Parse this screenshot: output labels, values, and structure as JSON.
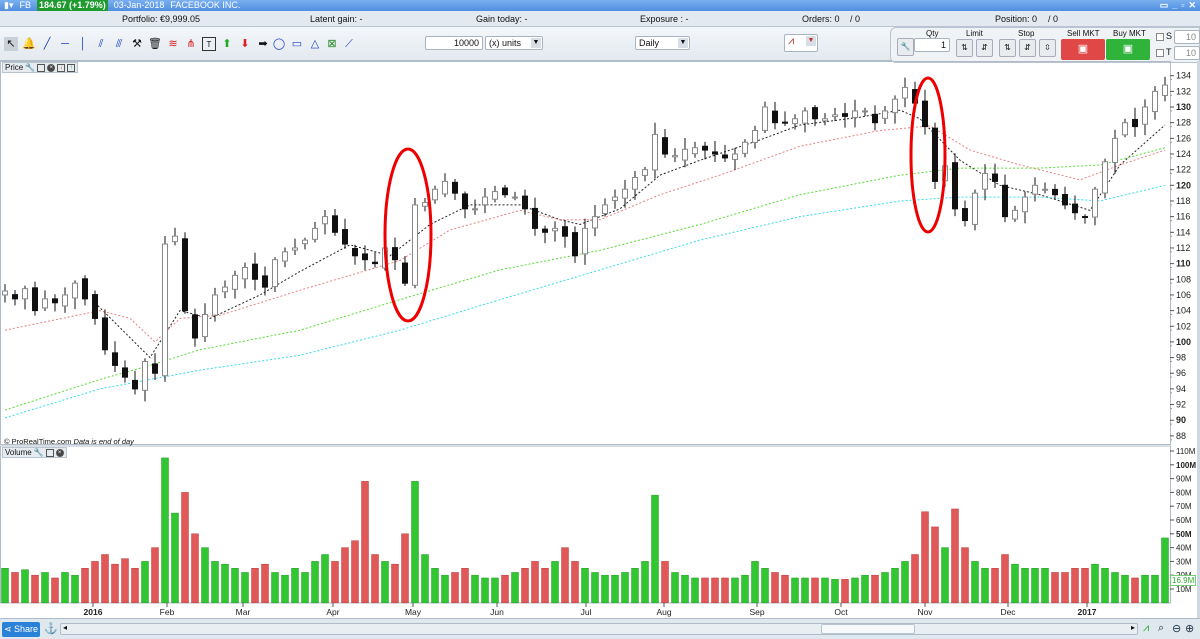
{
  "titlebar": {
    "symbol": "FB",
    "price_change": "184.67 (+1.79%)",
    "date": "03-Jan-2018",
    "name": "FACEBOOK INC.",
    "window_buttons": [
      "▭",
      "_",
      "▫",
      "✕"
    ]
  },
  "info": {
    "portfolio": "Portfolio: €9,999.05",
    "latent_gain": "Latent gain: -",
    "gain_today": "Gain today: -",
    "exposure": "Exposure : -",
    "orders": "Orders: 0",
    "orders_b": "/ 0",
    "position": "Position: 0",
    "position_b": "/ 0"
  },
  "toolbar": {
    "tools": [
      "pointer",
      "alert-bell",
      "trendline",
      "horizontal-line",
      "vertical-line",
      "parallel-channel",
      "fan-lines",
      "tools-settings",
      "trash",
      "fibonacci",
      "fibonacci-fan",
      "text",
      "up-arrow",
      "down-arrow",
      "right-arrow",
      "ellipse",
      "rectangle",
      "triangle",
      "zone",
      "segment"
    ],
    "amount": "10000",
    "units": "(x) units",
    "period": "Daily"
  },
  "trade": {
    "qty_label": "Qty",
    "qty": "1",
    "limit_label": "Limit",
    "stop_label": "Stop",
    "sell_label": "Sell MKT",
    "buy_label": "Buy MKT",
    "s_label": "S",
    "t_label": "T",
    "s_value": "10",
    "t_value": "10",
    "sell_color": "#e04848",
    "buy_color": "#2fb33a"
  },
  "price_panel": {
    "label": "Price",
    "copyright": "© ProRealTime.com",
    "note": "Data is end of day"
  },
  "volume_panel": {
    "label": "Volume",
    "current": "16.9M"
  },
  "bottom": {
    "share_label": "Share"
  },
  "chart_data": [
    {
      "type": "candlestick",
      "ylim": [
        88,
        134
      ],
      "yticks": [
        88,
        90,
        92,
        94,
        96,
        98,
        100,
        102,
        104,
        106,
        108,
        110,
        112,
        114,
        116,
        118,
        120,
        122,
        124,
        126,
        128,
        130,
        132,
        134
      ],
      "xticks": [
        "2016",
        "Feb",
        "Mar",
        "Apr",
        "May",
        "Jun",
        "Jul",
        "Aug",
        "Sep",
        "Oct",
        "Nov",
        "Dec",
        "2017"
      ],
      "closes": [
        106.5,
        105.5,
        106.8,
        104,
        105.5,
        105,
        106,
        107.5,
        105.5,
        103,
        99,
        97,
        95.5,
        94,
        97.5,
        96,
        112.5,
        113.5,
        104,
        100.5,
        103.5,
        106,
        107,
        108.5,
        109.5,
        108,
        107,
        110.5,
        111.5,
        112,
        113,
        114.5,
        116,
        114,
        112.5,
        111,
        110.5,
        110,
        112,
        110.5,
        107.5,
        117.5,
        117.8,
        119.5,
        120.5,
        119,
        117,
        117,
        118.5,
        119.2,
        118.8,
        118.5,
        117,
        114.5,
        114,
        114.5,
        113.5,
        111,
        114.5,
        116,
        117.5,
        118.5,
        119.5,
        121,
        122,
        126.5,
        124,
        123.8,
        124.6,
        124.8,
        124.5,
        124,
        123.5,
        124,
        125.5,
        127,
        130,
        128,
        128,
        128.5,
        129.5,
        128.5,
        128.5,
        129,
        128.8,
        129.5,
        129.5,
        128,
        129.5,
        131,
        132.5,
        130.5,
        127.5,
        120.5,
        122.5,
        117,
        115.5,
        119,
        121.5,
        120.5,
        116,
        116.8,
        118.5,
        120,
        119.5,
        118.8,
        117.5,
        116.5,
        116,
        119.5,
        123,
        126,
        128,
        127.5,
        130,
        132,
        132.8
      ],
      "moving_averages": [
        {
          "color": "#222222",
          "points": [
            [
              9,
              105
            ],
            [
              14.5,
              98
            ],
            [
              17.5,
              104
            ],
            [
              20.5,
              103
            ],
            [
              25.5,
              106
            ],
            [
              29.5,
              109
            ],
            [
              34.5,
              112.4
            ],
            [
              38.5,
              111
            ],
            [
              42.5,
              115
            ],
            [
              46.5,
              117.5
            ],
            [
              51.5,
              117.5
            ],
            [
              55.5,
              115.6
            ],
            [
              57.5,
              115
            ],
            [
              61.5,
              117
            ],
            [
              65.5,
              121.3
            ],
            [
              69.5,
              123.2
            ],
            [
              75.5,
              125.8
            ],
            [
              79.5,
              127.7
            ],
            [
              85.5,
              128.7
            ],
            [
              89.5,
              129.6
            ],
            [
              91.5,
              128.5
            ],
            [
              95.5,
              123.2
            ],
            [
              99.5,
              120
            ],
            [
              103.5,
              118.8
            ],
            [
              108.5,
              116.8
            ],
            [
              111.5,
              122.6
            ],
            [
              116,
              127.7
            ]
          ]
        },
        {
          "color": "#e88080",
          "points": [
            [
              0,
              101.5
            ],
            [
              9.5,
              104
            ],
            [
              12.5,
              103
            ],
            [
              15,
              100
            ],
            [
              17.5,
              103
            ],
            [
              21.5,
              103.4
            ],
            [
              29.5,
              106.6
            ],
            [
              39.5,
              110.4
            ],
            [
              44.5,
              114.3
            ],
            [
              51.5,
              116.8
            ],
            [
              55.5,
              115.6
            ],
            [
              59.5,
              115.6
            ],
            [
              65.5,
              118.8
            ],
            [
              71.5,
              121.3
            ],
            [
              79.5,
              125
            ],
            [
              87.5,
              127
            ],
            [
              92.5,
              127.6
            ],
            [
              96.5,
              124.5
            ],
            [
              101.5,
              122.6
            ],
            [
              107.5,
              120.7
            ],
            [
              111.5,
              122.6
            ],
            [
              116,
              124.5
            ]
          ]
        },
        {
          "color": "#55dd33",
          "points": [
            [
              0,
              91.3
            ],
            [
              9.5,
              95.2
            ],
            [
              14.5,
              97
            ],
            [
              19.5,
              99
            ],
            [
              29.5,
              101.5
            ],
            [
              39.5,
              105.4
            ],
            [
              44.5,
              107.3
            ],
            [
              49.5,
              109.2
            ],
            [
              59.5,
              111.7
            ],
            [
              69.5,
              115
            ],
            [
              79.5,
              118.8
            ],
            [
              89.5,
              121.3
            ],
            [
              95.5,
              122.2
            ],
            [
              103.5,
              122.2
            ],
            [
              109.5,
              122.6
            ],
            [
              116,
              124.8
            ]
          ]
        },
        {
          "color": "#33dde8",
          "points": [
            [
              0,
              90.3
            ],
            [
              9.5,
              94
            ],
            [
              14.5,
              95.2
            ],
            [
              19.5,
              96.4
            ],
            [
              29.5,
              98.3
            ],
            [
              39.5,
              101.5
            ],
            [
              49.5,
              105.4
            ],
            [
              59.5,
              109.2
            ],
            [
              69.5,
              113
            ],
            [
              79.5,
              116
            ],
            [
              89.5,
              118
            ],
            [
              95.5,
              118.5
            ],
            [
              103.5,
              118.5
            ],
            [
              109.5,
              118
            ],
            [
              116,
              120
            ]
          ]
        }
      ]
    },
    {
      "type": "bar",
      "ylabel_unit": "M",
      "ylim": [
        0,
        112
      ],
      "yticks": [
        "10M",
        "20M",
        "30M",
        "40M",
        "50M",
        "60M",
        "70M",
        "80M",
        "90M",
        "100M",
        "110M"
      ],
      "up_color": "#33c633",
      "down_color": "#e05858",
      "values": [
        25,
        22,
        24,
        20,
        22,
        18,
        22,
        20,
        25,
        30,
        35,
        28,
        32,
        25,
        30,
        40,
        105,
        65,
        80,
        50,
        40,
        30,
        28,
        25,
        22,
        25,
        28,
        22,
        20,
        25,
        22,
        30,
        35,
        30,
        40,
        45,
        88,
        35,
        30,
        28,
        50,
        88,
        35,
        25,
        20,
        22,
        25,
        20,
        18,
        18,
        20,
        22,
        25,
        30,
        25,
        30,
        40,
        30,
        25,
        22,
        20,
        20,
        22,
        25,
        30,
        78,
        30,
        22,
        20,
        18,
        18,
        18,
        18,
        18,
        20,
        30,
        25,
        22,
        20,
        18,
        18,
        18,
        18,
        17,
        17,
        18,
        20,
        20,
        22,
        25,
        30,
        35,
        66,
        55,
        40,
        68,
        40,
        30,
        25,
        25,
        35,
        28,
        25,
        25,
        25,
        22,
        22,
        25,
        25,
        28,
        25,
        22,
        20,
        18,
        20,
        20,
        47
      ]
    }
  ]
}
